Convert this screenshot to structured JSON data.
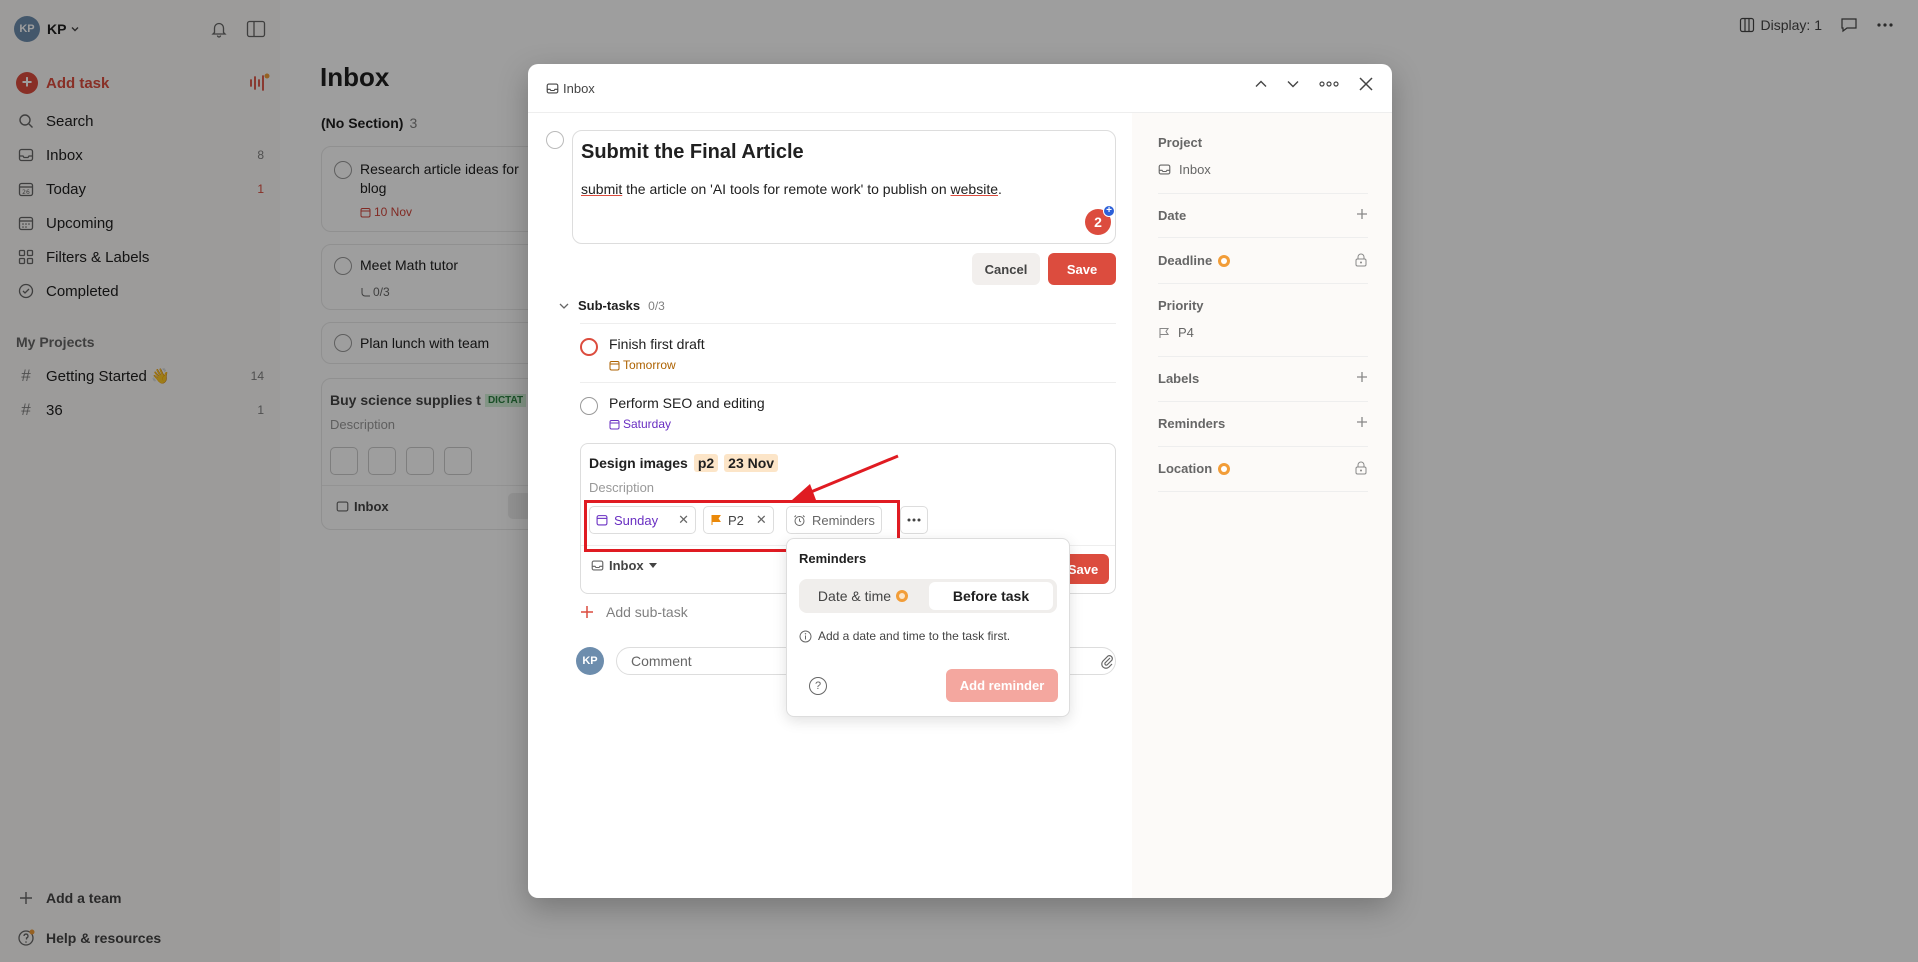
{
  "sidebar": {
    "avatar": "KP",
    "user": "KP",
    "add_task": "Add task",
    "items": [
      {
        "label": "Search",
        "count": ""
      },
      {
        "label": "Inbox",
        "count": "8"
      },
      {
        "label": "Today",
        "count": "1"
      },
      {
        "label": "Upcoming",
        "count": ""
      },
      {
        "label": "Filters & Labels",
        "count": ""
      },
      {
        "label": "Completed",
        "count": ""
      }
    ],
    "projects_title": "My Projects",
    "projects": [
      {
        "label": "Getting Started 👋",
        "count": "14"
      },
      {
        "label": "36",
        "count": "1"
      }
    ],
    "add_team": "Add a team",
    "help": "Help & resources"
  },
  "main": {
    "display_label": "Display: 1",
    "title": "Inbox",
    "section": "(No Section)",
    "section_count": "3",
    "tasks": [
      {
        "title": "Research article ideas for blog",
        "date": "10 Nov"
      },
      {
        "title": "Meet Math tutor",
        "meta": "0/3"
      },
      {
        "title": "Plan lunch with team"
      }
    ],
    "draft": {
      "title": "Buy science supplies t",
      "tag": "DICTAT",
      "description": "Description",
      "project": "Inbox"
    }
  },
  "modal": {
    "breadcrumb": "Inbox",
    "task_title": "Submit the Final Article",
    "description_parts": {
      "w1": "submit",
      "mid": " the article on 'AI tools for remote work' to publish on ",
      "w2": "website",
      "end": "."
    },
    "grammarly_count": "2",
    "cancel": "Cancel",
    "save": "Save",
    "subtasks_label": "Sub-tasks",
    "subtasks_count": "0/3",
    "subtasks": [
      {
        "title": "Finish first draft",
        "date": "Tomorrow"
      },
      {
        "title": "Perform SEO and editing",
        "date": "Saturday"
      }
    ],
    "subedit": {
      "title": "Design images",
      "chip1": "p2",
      "chip2": "23 Nov",
      "description": "Description",
      "date_pill": "Sunday",
      "priority_pill": "P2",
      "reminders_pill": "Reminders",
      "project": "Inbox",
      "save": "Save"
    },
    "add_subtask": "Add sub-task",
    "comment_avatar": "KP",
    "comment_placeholder": "Comment",
    "right": {
      "project_label": "Project",
      "project_value": "Inbox",
      "date_label": "Date",
      "deadline_label": "Deadline",
      "priority_label": "Priority",
      "priority_value": "P4",
      "labels_label": "Labels",
      "reminders_label": "Reminders",
      "location_label": "Location"
    }
  },
  "reminders_popup": {
    "title": "Reminders",
    "tab_datetime": "Date & time",
    "tab_before": "Before task",
    "info": "Add a date and time to the task first.",
    "add_button": "Add reminder"
  },
  "colors": {
    "accent": "#dc4c3e",
    "annotation_red": "#e01b22",
    "date_purple": "#692fc2",
    "date_orange": "#ad6200"
  }
}
